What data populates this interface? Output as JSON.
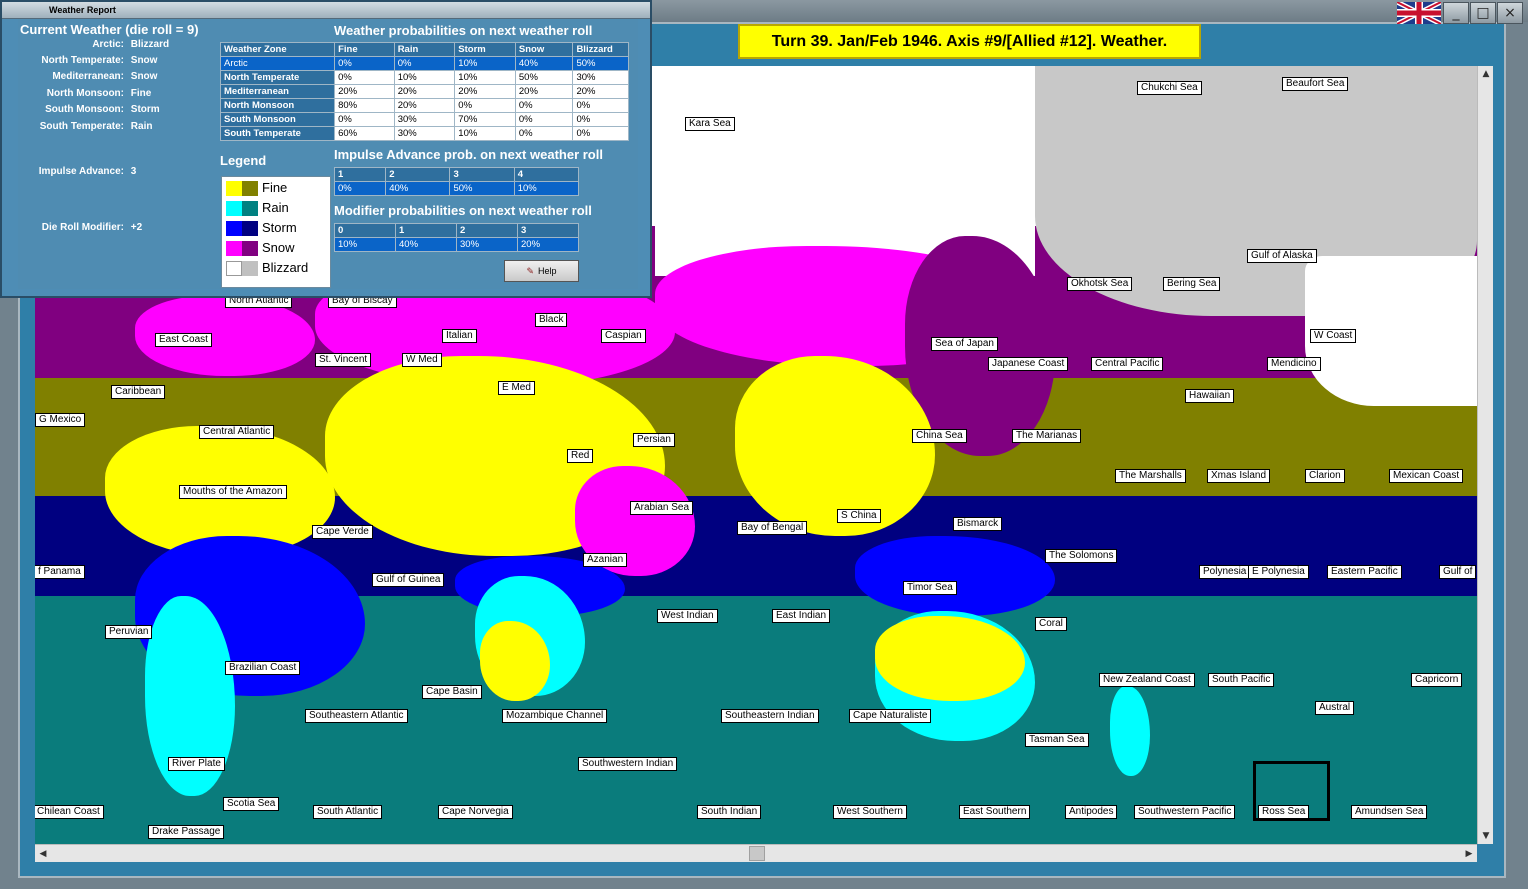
{
  "dialog": {
    "title": "Weather Report",
    "current_weather_title": "Current Weather (die roll = 9)",
    "current_weather": [
      {
        "zone": "Arctic:",
        "value": "Blizzard"
      },
      {
        "zone": "North Temperate:",
        "value": "Snow"
      },
      {
        "zone": "Mediterranean:",
        "value": "Snow"
      },
      {
        "zone": "North Monsoon:",
        "value": "Fine"
      },
      {
        "zone": "South Monsoon:",
        "value": "Storm"
      },
      {
        "zone": "South Temperate:",
        "value": "Rain"
      }
    ],
    "impulse_advance_label": "Impulse Advance:",
    "impulse_advance_value": "3",
    "die_roll_modifier_label": "Die Roll Modifier:",
    "die_roll_modifier_value": "+2",
    "prob_title": "Weather probabilities on next weather roll",
    "prob_headers": [
      "Weather Zone",
      "Fine",
      "Rain",
      "Storm",
      "Snow",
      "Blizzard"
    ],
    "prob_rows": [
      [
        "Arctic",
        "0%",
        "0%",
        "10%",
        "40%",
        "50%"
      ],
      [
        "North Temperate",
        "0%",
        "10%",
        "10%",
        "50%",
        "30%"
      ],
      [
        "Mediterranean",
        "20%",
        "20%",
        "20%",
        "20%",
        "20%"
      ],
      [
        "North Monsoon",
        "80%",
        "20%",
        "0%",
        "0%",
        "0%"
      ],
      [
        "South Monsoon",
        "0%",
        "30%",
        "70%",
        "0%",
        "0%"
      ],
      [
        "South Temperate",
        "60%",
        "30%",
        "10%",
        "0%",
        "0%"
      ]
    ],
    "impulse_title": "Impulse Advance prob. on next weather roll",
    "impulse_headers": [
      "1",
      "2",
      "3",
      "4"
    ],
    "impulse_values": [
      "0%",
      "40%",
      "50%",
      "10%"
    ],
    "modifier_title": "Modifier probabilities on next weather roll",
    "modifier_headers": [
      "0",
      "1",
      "2",
      "3"
    ],
    "modifier_values": [
      "10%",
      "40%",
      "30%",
      "20%"
    ],
    "legend_title": "Legend",
    "legend": [
      {
        "label": "Fine",
        "colors": [
          "#ffff00",
          "#808000"
        ]
      },
      {
        "label": "Rain",
        "colors": [
          "#00ffff",
          "#008080"
        ]
      },
      {
        "label": "Storm",
        "colors": [
          "#0000ff",
          "#000080"
        ]
      },
      {
        "label": "Snow",
        "colors": [
          "#ff00ff",
          "#800080"
        ]
      },
      {
        "label": "Blizzard",
        "colors": [
          "#ffffff",
          "#c0c0c0"
        ]
      }
    ],
    "help_label": "Help",
    "help_icon": "help-book-icon"
  },
  "turn_banner": "Turn 39.  Jan/Feb 1946.  Axis #9/[Allied #12].  Weather.",
  "window_controls": {
    "flag_icon": "union-jack-flag-icon",
    "minimize": "_",
    "maximize": "□",
    "close": "×"
  },
  "sea_zones": [
    {
      "name": "Kara Sea"
    },
    {
      "name": "Chukchi Sea"
    },
    {
      "name": "Beaufort Sea"
    },
    {
      "name": "Okhotsk Sea"
    },
    {
      "name": "Bering Sea"
    },
    {
      "name": "Gulf of Alaska"
    },
    {
      "name": "North Atlantic"
    },
    {
      "name": "Bay of Biscay"
    },
    {
      "name": "East Coast"
    },
    {
      "name": "Black"
    },
    {
      "name": "Caspian"
    },
    {
      "name": "Italian"
    },
    {
      "name": "Sea of Japan"
    },
    {
      "name": "W Coast"
    },
    {
      "name": "St. Vincent"
    },
    {
      "name": "W Med"
    },
    {
      "name": "Japanese Coast"
    },
    {
      "name": "Central Pacific"
    },
    {
      "name": "Mendicino"
    },
    {
      "name": "Caribbean"
    },
    {
      "name": "E Med"
    },
    {
      "name": "Hawaiian"
    },
    {
      "name": "G Mexico"
    },
    {
      "name": "Central Atlantic"
    },
    {
      "name": "China Sea"
    },
    {
      "name": "The Marianas"
    },
    {
      "name": "Persian"
    },
    {
      "name": "Red"
    },
    {
      "name": "The Marshalls"
    },
    {
      "name": "Xmas Island"
    },
    {
      "name": "Clarion"
    },
    {
      "name": "Mexican Coast"
    },
    {
      "name": "Mouths of the Amazon"
    },
    {
      "name": "Arabian Sea"
    },
    {
      "name": "S China"
    },
    {
      "name": "Bismarck"
    },
    {
      "name": "Bay of Bengal"
    },
    {
      "name": "Cape Verde"
    },
    {
      "name": "Azanian"
    },
    {
      "name": "The Solomons"
    },
    {
      "name": "f Panama"
    },
    {
      "name": "Gulf of Guinea"
    },
    {
      "name": "Polynesia"
    },
    {
      "name": "E Polynesia"
    },
    {
      "name": "Eastern Pacific"
    },
    {
      "name": "Gulf of"
    },
    {
      "name": "Timor Sea"
    },
    {
      "name": "West Indian"
    },
    {
      "name": "East Indian"
    },
    {
      "name": "Peruvian"
    },
    {
      "name": "Coral"
    },
    {
      "name": "Brazilian Coast"
    },
    {
      "name": "New Zealand Coast"
    },
    {
      "name": "South Pacific"
    },
    {
      "name": "Capricorn"
    },
    {
      "name": "Cape Basin"
    },
    {
      "name": "Austral"
    },
    {
      "name": "Southeastern Atlantic"
    },
    {
      "name": "Mozambique Channel"
    },
    {
      "name": "Southeastern Indian"
    },
    {
      "name": "Cape Naturaliste"
    },
    {
      "name": "Tasman Sea"
    },
    {
      "name": "River Plate"
    },
    {
      "name": "Southwestern Indian"
    },
    {
      "name": "Scotia Sea"
    },
    {
      "name": "Chilean Coast"
    },
    {
      "name": "South Atlantic"
    },
    {
      "name": "Cape Norvegia"
    },
    {
      "name": "South Indian"
    },
    {
      "name": "West Southern"
    },
    {
      "name": "East Southern"
    },
    {
      "name": "Antipodes"
    },
    {
      "name": "Southwestern Pacific"
    },
    {
      "name": "Ross Sea"
    },
    {
      "name": "Amundsen Sea"
    },
    {
      "name": "Drake Passage"
    }
  ]
}
